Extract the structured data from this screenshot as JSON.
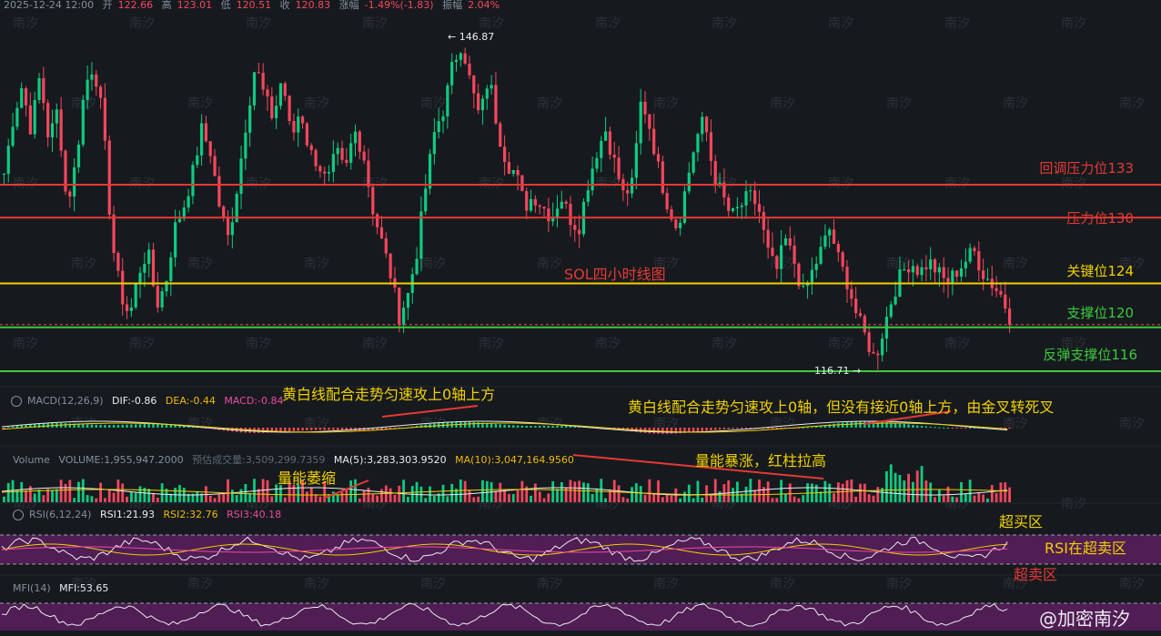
{
  "header": {
    "datetime": "2025-12-24 12:00",
    "open_label": "开",
    "open": "122.66",
    "high_label": "高",
    "high": "123.01",
    "low_label": "低",
    "low": "120.51",
    "close_label": "收",
    "close": "120.83",
    "change_label": "涨幅",
    "change": "-1.49%(-1.83)",
    "amplitude_label": "振幅",
    "amplitude": "2.04%"
  },
  "price_markers": {
    "high": "← 146.87",
    "low": "116.71 →"
  },
  "levels": [
    {
      "label": "回调压力位133",
      "value": 133,
      "color": "#e53935"
    },
    {
      "label": "压力位130",
      "value": 130,
      "color": "#e53935"
    },
    {
      "label": "关键位124",
      "value": 124,
      "color": "#f0d000"
    },
    {
      "label": "支撑位120",
      "value": 120,
      "color": "#3cc83c"
    },
    {
      "label": "反弹支撑位116",
      "value": 116,
      "color": "#3cc83c"
    }
  ],
  "chart_title": "SOL四小时线图",
  "macd": {
    "name": "MACD(12,26,9)",
    "dif": "DIF:-0.86",
    "dea": "DEA:-0.44",
    "macd": "MACD:-0.84",
    "note1": "黄白线配合走势匀速攻上0轴上方",
    "note2": "黄白线配合走势匀速攻上0轴，但没有接近0轴上方，由金叉转死叉"
  },
  "volume": {
    "name": "Volume",
    "vol": "VOLUME:1,955,947.2000",
    "est": "预估成交量:3,509,299.7359",
    "ma5": "MA(5):3,283,303.9520",
    "ma10": "MA(10):3,047,164.9560",
    "note_low": "量能萎缩",
    "note_high": "量能暴涨，红柱拉高"
  },
  "rsi": {
    "name": "RSI(6,12,24)",
    "rsi1": "RSI1:21.93",
    "rsi2": "RSI2:32.76",
    "rsi3": "RSI3:40.18",
    "overbought": "超买区",
    "in_oversold": "RSI在超卖区",
    "oversold": "超卖区"
  },
  "mfi": {
    "name": "MFI(14)",
    "mfi": "MFI:53.65"
  },
  "watermark": "@加密南汐",
  "watermark_tiles": "南汐",
  "colors": {
    "up": "#0ecb81",
    "down": "#f6465d",
    "bg": "#161a1e",
    "yellow": "#f0d000",
    "white": "#eaecef",
    "pink": "#e94ba4",
    "purple_band": "#5a1f5e"
  },
  "chart_data": {
    "type": "candlestick",
    "title": "SOL四小时线图",
    "ylim": [
      115,
      149
    ],
    "horizontal_levels": [
      133,
      130,
      124,
      120,
      116
    ],
    "close_path": [
      134,
      139,
      142,
      138,
      143,
      137,
      140,
      131,
      135,
      142,
      144,
      139,
      128,
      123,
      121,
      125,
      127,
      122,
      124,
      129,
      131,
      134,
      138,
      136,
      131,
      128,
      133,
      139,
      144,
      141,
      139,
      143,
      137,
      140,
      136,
      135,
      133,
      136,
      134,
      138,
      136,
      131,
      128,
      125,
      121,
      123,
      127,
      133,
      138,
      140,
      144,
      146,
      142,
      139,
      143,
      138,
      135,
      134,
      131,
      132,
      131,
      130,
      132,
      130,
      129,
      133,
      136,
      138,
      135,
      132,
      133,
      141,
      138,
      134,
      131,
      129,
      133,
      137,
      139,
      134,
      132,
      130,
      131,
      132,
      131,
      127,
      125,
      128,
      126,
      123,
      125,
      127,
      129,
      126,
      124,
      121,
      119,
      117,
      120,
      123,
      125,
      126,
      125,
      126,
      125,
      124,
      125,
      126,
      127,
      125,
      124,
      123,
      121
    ]
  }
}
